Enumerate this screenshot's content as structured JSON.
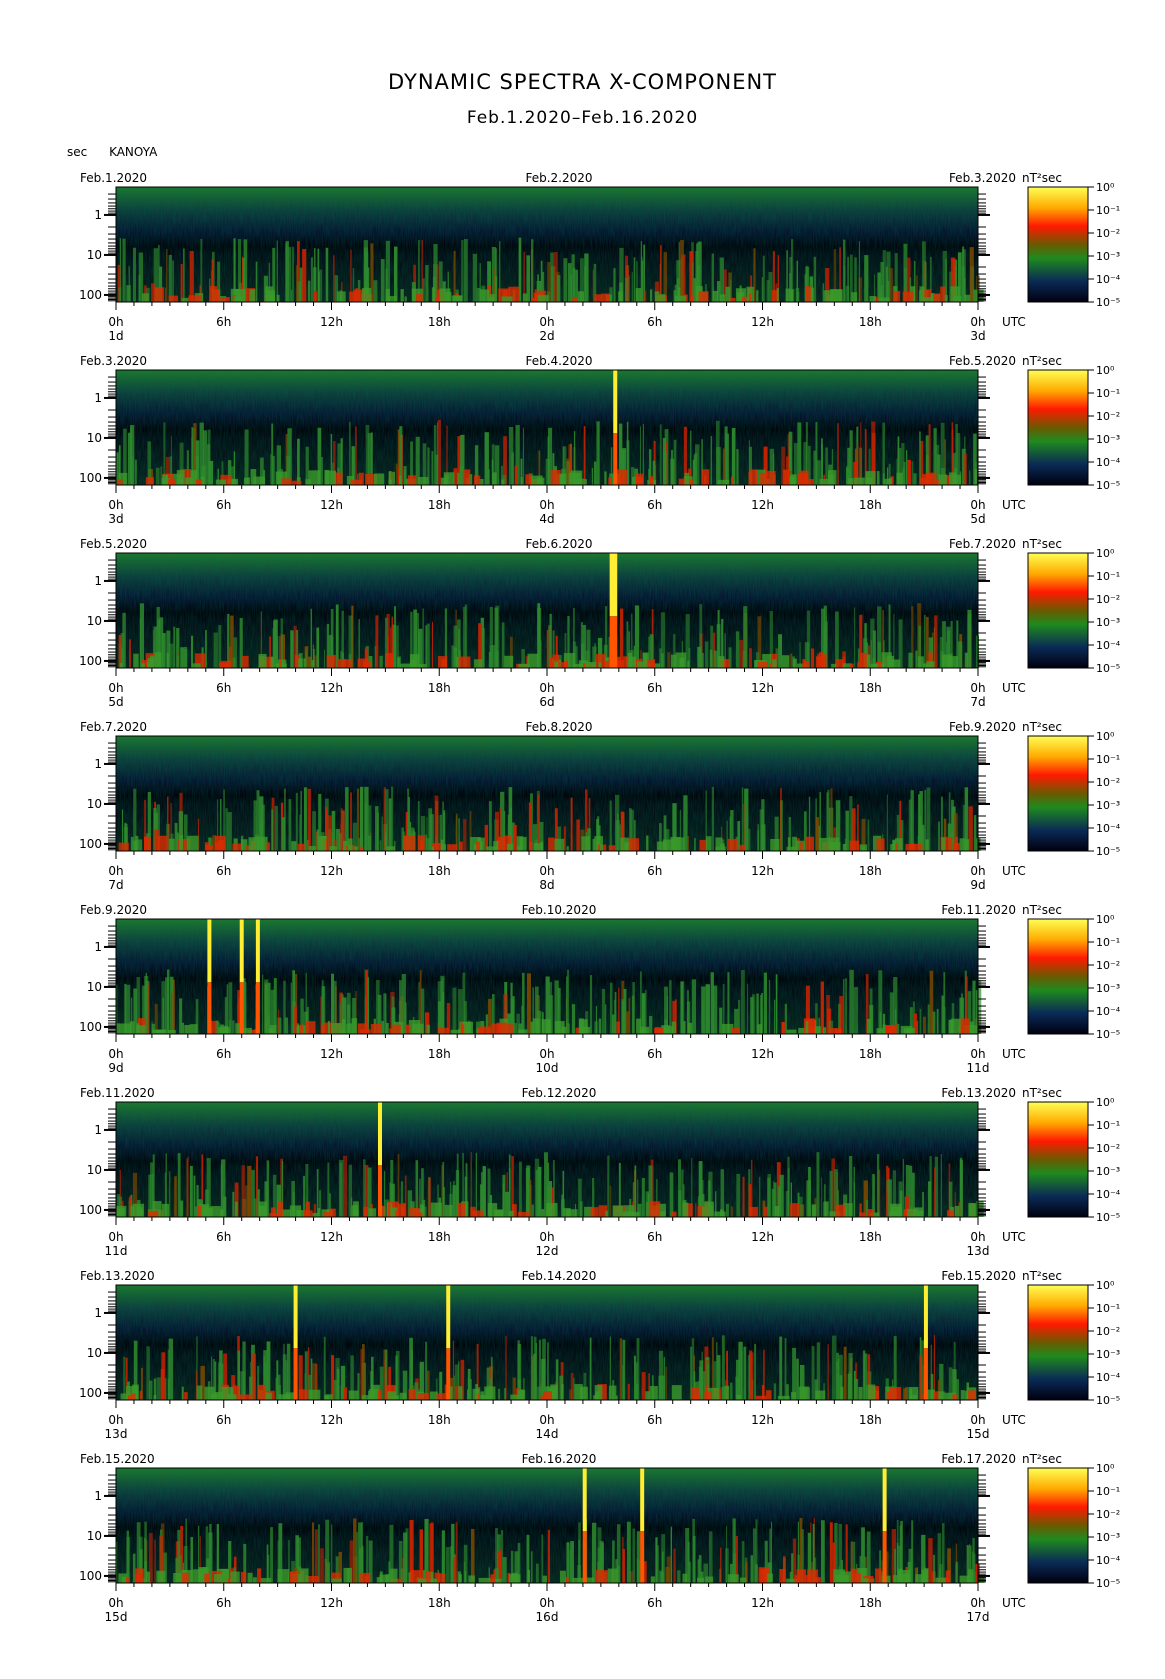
{
  "title": "DYNAMIC SPECTRA X-COMPONENT",
  "subtitle": "Feb.1.2020–Feb.16.2020",
  "header": {
    "unit_left": "sec",
    "station": "KANOYA"
  },
  "colorbar": {
    "unit": "nT²sec",
    "labels": [
      "10⁰",
      "10⁻¹",
      "10⁻²",
      "10⁻³",
      "10⁻⁴",
      "10⁻⁵"
    ],
    "colors": [
      "#ffff66",
      "#ff9900",
      "#ff2200",
      "#7a2a00",
      "#228822",
      "#0a1a44",
      "#000000"
    ]
  },
  "chart_data": {
    "type": "heatmap",
    "x_axis_units": "UTC hours",
    "y_axis_label": "sec",
    "y_ticks": [
      "1",
      "10",
      "100"
    ],
    "x_tick_labels": [
      "0h",
      "6h",
      "12h",
      "18h",
      "0h",
      "6h",
      "12h",
      "18h",
      "0h"
    ],
    "x_end_label": "UTC",
    "panels": [
      {
        "date_left": "Feb.1.2020",
        "date_mid": "Feb.2.2020",
        "date_right": "Feb.3.2020",
        "day_labels": [
          "1d",
          "2d",
          "3d"
        ],
        "spikes_hours": []
      },
      {
        "date_left": "Feb.3.2020",
        "date_mid": "Feb.4.2020",
        "date_right": "Feb.5.2020",
        "day_labels": [
          "3d",
          "4d",
          "5d"
        ],
        "spikes_hours": [
          27.8
        ]
      },
      {
        "date_left": "Feb.5.2020",
        "date_mid": "Feb.6.2020",
        "date_right": "Feb.7.2020",
        "day_labels": [
          "5d",
          "6d",
          "7d"
        ],
        "spikes_hours": [
          27.6,
          27.8
        ]
      },
      {
        "date_left": "Feb.7.2020",
        "date_mid": "Feb.8.2020",
        "date_right": "Feb.9.2020",
        "day_labels": [
          "7d",
          "8d",
          "9d"
        ],
        "spikes_hours": []
      },
      {
        "date_left": "Feb.9.2020",
        "date_mid": "Feb.10.2020",
        "date_right": "Feb.11.2020",
        "day_labels": [
          "9d",
          "10d",
          "11d"
        ],
        "spikes_hours": [
          5.2,
          7.0,
          7.9
        ]
      },
      {
        "date_left": "Feb.11.2020",
        "date_mid": "Feb.12.2020",
        "date_right": "Feb.13.2020",
        "day_labels": [
          "11d",
          "12d",
          "13d"
        ],
        "spikes_hours": [
          14.7
        ]
      },
      {
        "date_left": "Feb.13.2020",
        "date_mid": "Feb.14.2020",
        "date_right": "Feb.15.2020",
        "day_labels": [
          "13d",
          "14d",
          "15d"
        ],
        "spikes_hours": [
          10.0,
          18.5,
          45.1
        ]
      },
      {
        "date_left": "Feb.15.2020",
        "date_mid": "Feb.16.2020",
        "date_right": "Feb.17.2020",
        "day_labels": [
          "15d",
          "16d",
          "17d"
        ],
        "spikes_hours": [
          26.1,
          29.3,
          42.8
        ]
      }
    ]
  }
}
